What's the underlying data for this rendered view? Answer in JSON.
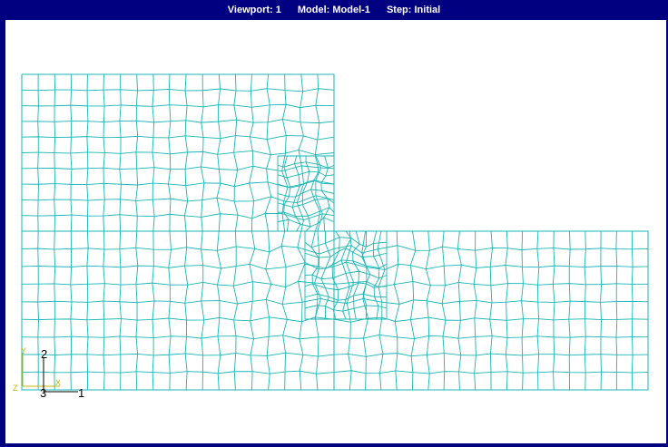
{
  "title_bar": {
    "viewport": "Viewport: 1",
    "model": "Model: Model-1",
    "step": "Step: Initial"
  },
  "colors": {
    "frame": "#000080",
    "canvas": "#ffffff",
    "mesh": "#19b5b5",
    "triad_minor": "#c8b400",
    "triad_major": "#000000"
  },
  "triad": {
    "axis_y_small": "Y",
    "axis_x_small": "X",
    "axis_z_small": "Z",
    "axis_2": "2",
    "axis_1": "1",
    "axis_3": "3"
  }
}
